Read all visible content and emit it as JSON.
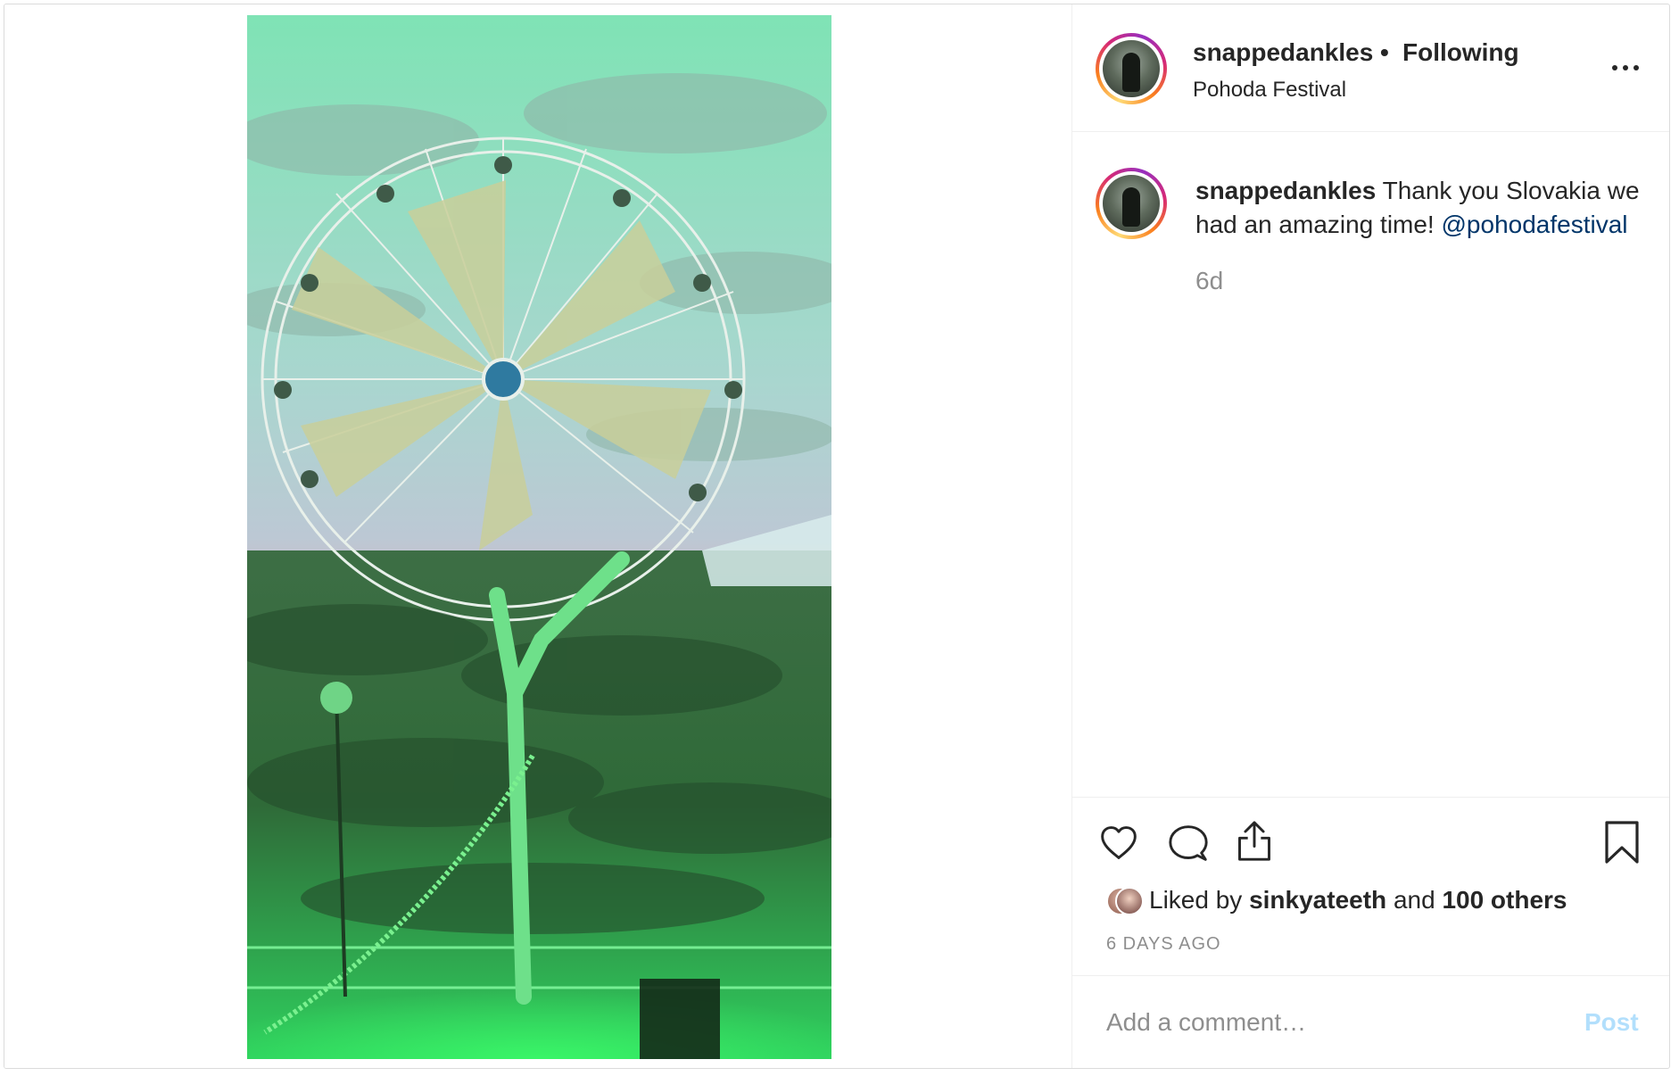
{
  "header": {
    "username": "snappedankles",
    "separator": "•",
    "follow_status": "Following",
    "location": "Pohoda Festival",
    "more_icon": "more-horizontal-icon"
  },
  "caption": {
    "username": "snappedankles",
    "text": "Thank you Slovakia we had an amazing time!",
    "mention": "@pohodafestival",
    "time": "6d"
  },
  "actions": {
    "like_icon": "heart-icon",
    "comment_icon": "comment-bubble-icon",
    "share_icon": "share-icon",
    "save_icon": "bookmark-icon"
  },
  "likes": {
    "prefix": "Liked by",
    "user": "sinkyateeth",
    "conj": "and",
    "others": "100 others"
  },
  "posted_ago": "6 DAYS AGO",
  "comment": {
    "placeholder": "Add a comment…",
    "post_label": "Post"
  },
  "colors": {
    "mention": "#003569",
    "muted": "#8e8e8e",
    "post_disabled": "#b2dffc",
    "photo_tint": "#2fd66a"
  }
}
